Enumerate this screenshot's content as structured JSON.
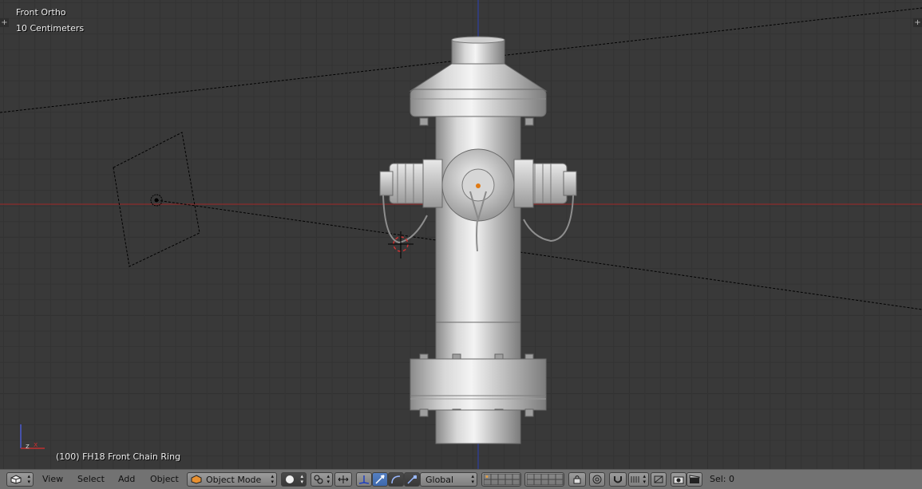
{
  "viewport": {
    "view_name": "Front Ortho",
    "grid_scale": "10 Centimeters",
    "object_info": "(100) FH18 Front Chain Ring",
    "axis_colors": {
      "x_axis": "#8c2b2b",
      "z_axis": "#2f3fa0",
      "background": "#393939"
    }
  },
  "header": {
    "editor_type_icon": "cube-icon",
    "menus": [
      "View",
      "Select",
      "Add",
      "Object"
    ],
    "mode": "Object Mode",
    "shading_icon": "solid-sphere-icon",
    "pivot_icon": "pivot-point-icon",
    "transform_orientation": "Global",
    "selection_count": "Sel: 0"
  }
}
